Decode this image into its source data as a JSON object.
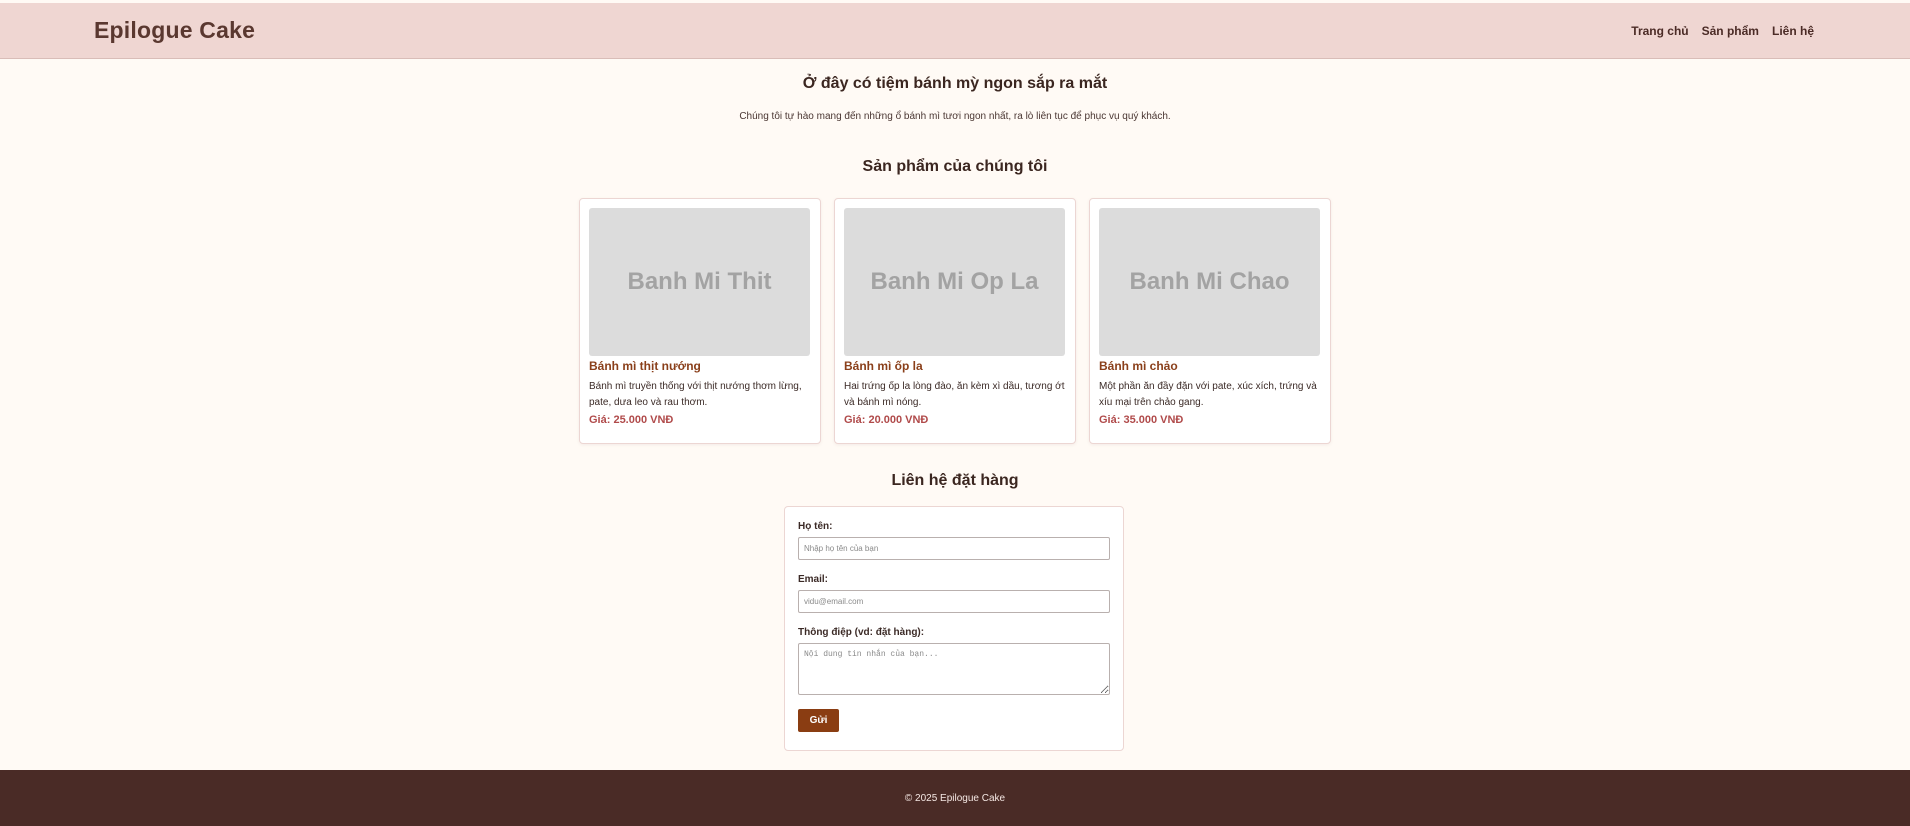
{
  "header": {
    "brand": "Epilogue Cake",
    "nav": [
      {
        "label": "Trang chủ"
      },
      {
        "label": "Sản phẩm"
      },
      {
        "label": "Liên hệ"
      }
    ]
  },
  "intro": {
    "title": "Ở đây có tiệm bánh mỳ ngon sắp ra mắt",
    "description": "Chúng tôi tự hào mang đến những ổ bánh mì tươi ngon nhất, ra lò liên tục để phục vụ quý khách."
  },
  "products": {
    "section_title": "Sản phẩm của chúng tôi",
    "items": [
      {
        "image_alt": "Banh Mi Thit",
        "name": "Bánh mì thịt nướng",
        "description": "Bánh mì truyền thống với thịt nướng thơm lừng, pate, dưa leo và rau thơm.",
        "price": "Giá: 25.000 VNĐ"
      },
      {
        "image_alt": "Banh Mi Op La",
        "name": "Bánh mì ốp la",
        "description": "Hai trứng ốp la lòng đào, ăn kèm xì dầu, tương ớt và bánh mì nóng.",
        "price": "Giá: 20.000 VNĐ"
      },
      {
        "image_alt": "Banh Mi Chao",
        "name": "Bánh mì chảo",
        "description": "Một phần ăn đầy đặn với pate, xúc xích, trứng và xíu mại trên chảo gang.",
        "price": "Giá: 35.000 VNĐ"
      }
    ]
  },
  "contact": {
    "section_title": "Liên hệ đặt hàng",
    "name_label": "Họ tên:",
    "name_placeholder": "Nhập họ tên của bạn",
    "email_label": "Email:",
    "email_placeholder": "vidu@email.com",
    "message_label": "Thông điệp (vd: đặt hàng):",
    "message_placeholder": "Nội dung tin nhắn của bạn...",
    "submit_label": "Gửi"
  },
  "footer": {
    "copyright": "© 2025 Epilogue Cake"
  },
  "colors": {
    "header_bg": "#efd6d2",
    "page_bg": "#fffaf5",
    "product_name": "#8a3f1a",
    "price": "#b04a4a",
    "button": "#8a3d12",
    "footer_bg": "#4a2b26"
  }
}
